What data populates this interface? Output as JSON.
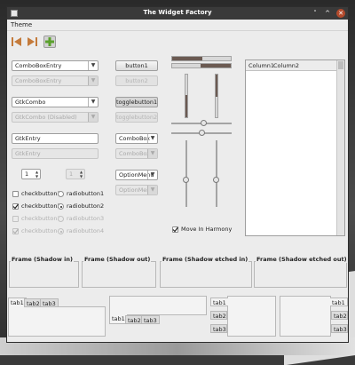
{
  "window": {
    "title": "The Widget Factory",
    "controls": {
      "minimize": "˅",
      "maximize": "^",
      "close": "✕"
    }
  },
  "menubar": {
    "items": [
      "Theme"
    ]
  },
  "toolbar": {
    "items": [
      {
        "name": "go-first-icon",
        "icon": "go-first"
      },
      {
        "name": "go-last-icon",
        "icon": "go-last"
      },
      {
        "name": "add-icon",
        "icon": "add"
      }
    ]
  },
  "left": {
    "combo_entry": "ComboBoxEntry",
    "combo_entry_disabled": "ComboBoxEntry",
    "gtk_combo": "GtkCombo",
    "gtk_combo_disabled": "GtkCombo (Disabled)",
    "gtk_entry": "GtkEntry",
    "gtk_entry_disabled": "GtkEntry",
    "spin_value": "1",
    "spin_disabled_value": "1",
    "checks": [
      {
        "label": "checkbutton1",
        "checked": false,
        "disabled": false
      },
      {
        "label": "checkbutton2",
        "checked": true,
        "disabled": false
      },
      {
        "label": "checkbutton3",
        "checked": false,
        "disabled": true
      },
      {
        "label": "checkbutton4",
        "checked": true,
        "disabled": true
      }
    ],
    "radios": [
      {
        "label": "radiobutton1",
        "selected": false,
        "disabled": false
      },
      {
        "label": "radiobutton2",
        "selected": true,
        "disabled": false
      },
      {
        "label": "radiobutton3",
        "selected": false,
        "disabled": true
      },
      {
        "label": "radiobutton4",
        "selected": true,
        "disabled": true
      }
    ]
  },
  "middle": {
    "button1": "button1",
    "button2": "button2",
    "togglebutton1": "togglebutton1",
    "togglebutton2": "togglebutton2",
    "combobox": "ComboBox",
    "combobox_disabled": "ComboBox",
    "optionmenu": "OptionMenu",
    "optionmenu_disabled": "OptionMenu"
  },
  "sliders": {
    "move_in_harmony_label": "Move In Harmony",
    "move_in_harmony": true
  },
  "tree": {
    "columns": [
      "Column1",
      "Column2"
    ]
  },
  "frames": [
    "Frame (Shadow in)",
    "Frame (Shadow out)",
    "Frame (Shadow etched in)",
    "Frame (Shadow etched out)"
  ],
  "notebooks": {
    "tabs": [
      "tab1",
      "tab2",
      "tab3"
    ]
  },
  "colors": {
    "titlebar": "#3a3a3a",
    "slider_fill": "#6b5a52",
    "close_button": "#b34a2c",
    "add_icon": "#5aa02c"
  }
}
